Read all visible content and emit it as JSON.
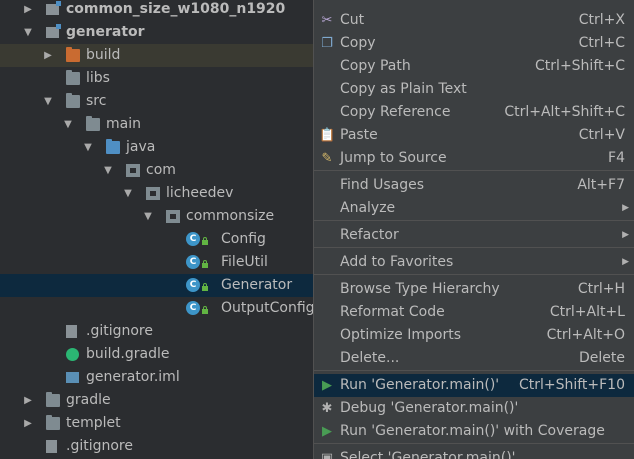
{
  "tree": [
    {
      "label": "common_size_w1080_n1920",
      "arrow": "▶",
      "icon": "module",
      "bold": true
    },
    {
      "label": "generator",
      "arrow": "▼",
      "icon": "module",
      "bold": true
    },
    {
      "label": "build",
      "arrow": "▶",
      "icon": "folder-orange"
    },
    {
      "label": "libs",
      "arrow": "",
      "icon": "folder"
    },
    {
      "label": "src",
      "arrow": "▼",
      "icon": "folder"
    },
    {
      "label": "main",
      "arrow": "▼",
      "icon": "folder"
    },
    {
      "label": "java",
      "arrow": "▼",
      "icon": "folder-blue"
    },
    {
      "label": "com",
      "arrow": "▼",
      "icon": "package"
    },
    {
      "label": "licheedev",
      "arrow": "▼",
      "icon": "package"
    },
    {
      "label": "commonsize",
      "arrow": "▼",
      "icon": "package"
    },
    {
      "label": "Config",
      "arrow": "",
      "icon": "class"
    },
    {
      "label": "FileUtil",
      "arrow": "",
      "icon": "class"
    },
    {
      "label": "Generator",
      "arrow": "",
      "icon": "class"
    },
    {
      "label": "OutputConfig",
      "arrow": "",
      "icon": "class"
    },
    {
      "label": ".gitignore",
      "arrow": "",
      "icon": "file"
    },
    {
      "label": "build.gradle",
      "arrow": "",
      "icon": "gradle"
    },
    {
      "label": "generator.iml",
      "arrow": "",
      "icon": "iml"
    },
    {
      "label": "gradle",
      "arrow": "▶",
      "icon": "folder"
    },
    {
      "label": "templet",
      "arrow": "▶",
      "icon": "folder"
    },
    {
      "label": ".gitignore",
      "arrow": "",
      "icon": "file"
    }
  ],
  "menu": [
    {
      "label": "Cut",
      "shortcut": "Ctrl+X",
      "icon": "scissors-icon",
      "glyph": "✂"
    },
    {
      "label": "Copy",
      "shortcut": "Ctrl+C",
      "icon": "copy-icon",
      "glyph": "❐"
    },
    {
      "label": "Copy Path",
      "shortcut": "Ctrl+Shift+C"
    },
    {
      "label": "Copy as Plain Text",
      "shortcut": ""
    },
    {
      "label": "Copy Reference",
      "shortcut": "Ctrl+Alt+Shift+C"
    },
    {
      "label": "Paste",
      "shortcut": "Ctrl+V",
      "icon": "paste-icon",
      "glyph": "📋"
    },
    {
      "label": "Jump to Source",
      "shortcut": "F4",
      "icon": "jump-to-source-icon",
      "glyph": "✎"
    },
    {
      "label": "Find Usages",
      "shortcut": "Alt+F7"
    },
    {
      "label": "Analyze",
      "shortcut": "",
      "submenu": true
    },
    {
      "label": "Refactor",
      "shortcut": "",
      "submenu": true
    },
    {
      "label": "Add to Favorites",
      "shortcut": "",
      "submenu": true
    },
    {
      "label": "Browse Type Hierarchy",
      "shortcut": "Ctrl+H"
    },
    {
      "label": "Reformat Code",
      "shortcut": "Ctrl+Alt+L"
    },
    {
      "label": "Optimize Imports",
      "shortcut": "Ctrl+Alt+O"
    },
    {
      "label": "Delete...",
      "shortcut": "Delete"
    },
    {
      "label": "Run 'Generator.main()'",
      "shortcut": "Ctrl+Shift+F10",
      "icon": "run-icon",
      "glyph": "▶"
    },
    {
      "label": "Debug 'Generator.main()'",
      "shortcut": "",
      "icon": "debug-icon",
      "glyph": "✱"
    },
    {
      "label": "Run 'Generator.main()' with Coverage",
      "shortcut": "",
      "icon": "coverage-icon",
      "glyph": "▶"
    },
    {
      "label": "Select 'Generator.main()'",
      "shortcut": "",
      "icon": "select-config-icon",
      "glyph": "▣"
    }
  ],
  "colors": {
    "run": "#499c54",
    "debug": "#b0b0b0",
    "selected_bg": "#0d293e",
    "menu_bg": "#3c3f41",
    "tree_bg": "#2b2d30"
  }
}
